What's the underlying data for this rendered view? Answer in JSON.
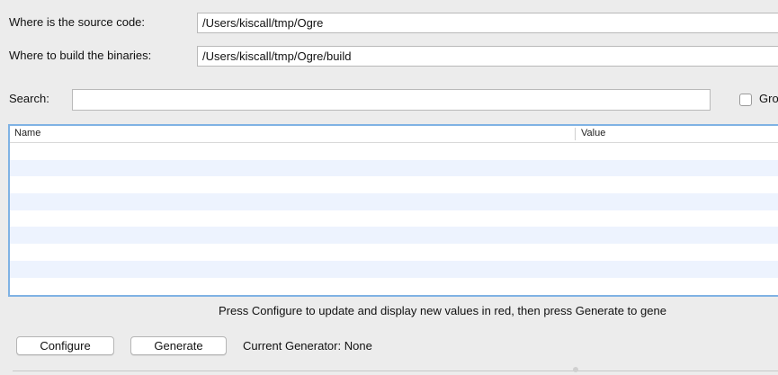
{
  "source": {
    "label": "Where is the source code:",
    "value": "/Users/kiscall/tmp/Ogre"
  },
  "build": {
    "label": "Where to build the binaries:",
    "value": "/Users/kiscall/tmp/Ogre/build"
  },
  "search": {
    "label": "Search:",
    "value": ""
  },
  "grouped": {
    "label": "Gro",
    "checked": false
  },
  "table": {
    "headers": [
      "Name",
      "Value"
    ],
    "rows": 9
  },
  "status_message": "Press Configure to update and display new values in red, then press Generate to gene",
  "buttons": {
    "configure": "Configure",
    "generate": "Generate"
  },
  "current_generator": "Current Generator: None",
  "colors": {
    "background": "#ececec",
    "table_focus_border": "#7fb2e4",
    "alt_row": "#edf3fe"
  }
}
